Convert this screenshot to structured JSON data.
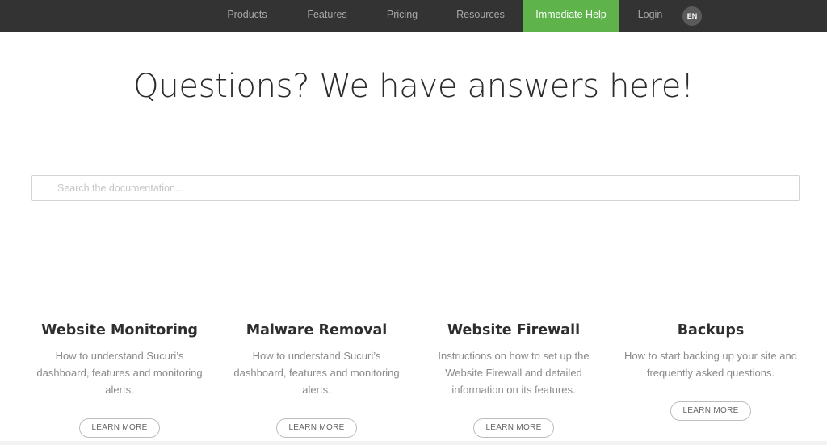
{
  "nav": {
    "items": [
      {
        "label": "Products"
      },
      {
        "label": "Features"
      },
      {
        "label": "Pricing"
      },
      {
        "label": "Resources"
      },
      {
        "label": "Immediate Help"
      },
      {
        "label": "Login"
      }
    ],
    "language": "EN",
    "accent_color": "#5eb34a",
    "background_color": "#333333"
  },
  "hero": {
    "title": "Questions? We have answers here!"
  },
  "search": {
    "placeholder": "Search the documentation..."
  },
  "cards": [
    {
      "title": "Website Monitoring",
      "description": "How to understand Sucuri’s dashboard, features and monitoring alerts.",
      "button": "LEARN MORE"
    },
    {
      "title": "Malware Removal",
      "description": "How to understand Sucuri’s dashboard, features and monitoring alerts.",
      "button": "LEARN MORE"
    },
    {
      "title": "Website Firewall",
      "description": "Instructions on how to set up the Website Firewall and detailed information on its features.",
      "button": "LEARN MORE"
    },
    {
      "title": "Backups",
      "description": "How to start backing up your site and frequently asked questions.",
      "button": "LEARN MORE"
    }
  ]
}
